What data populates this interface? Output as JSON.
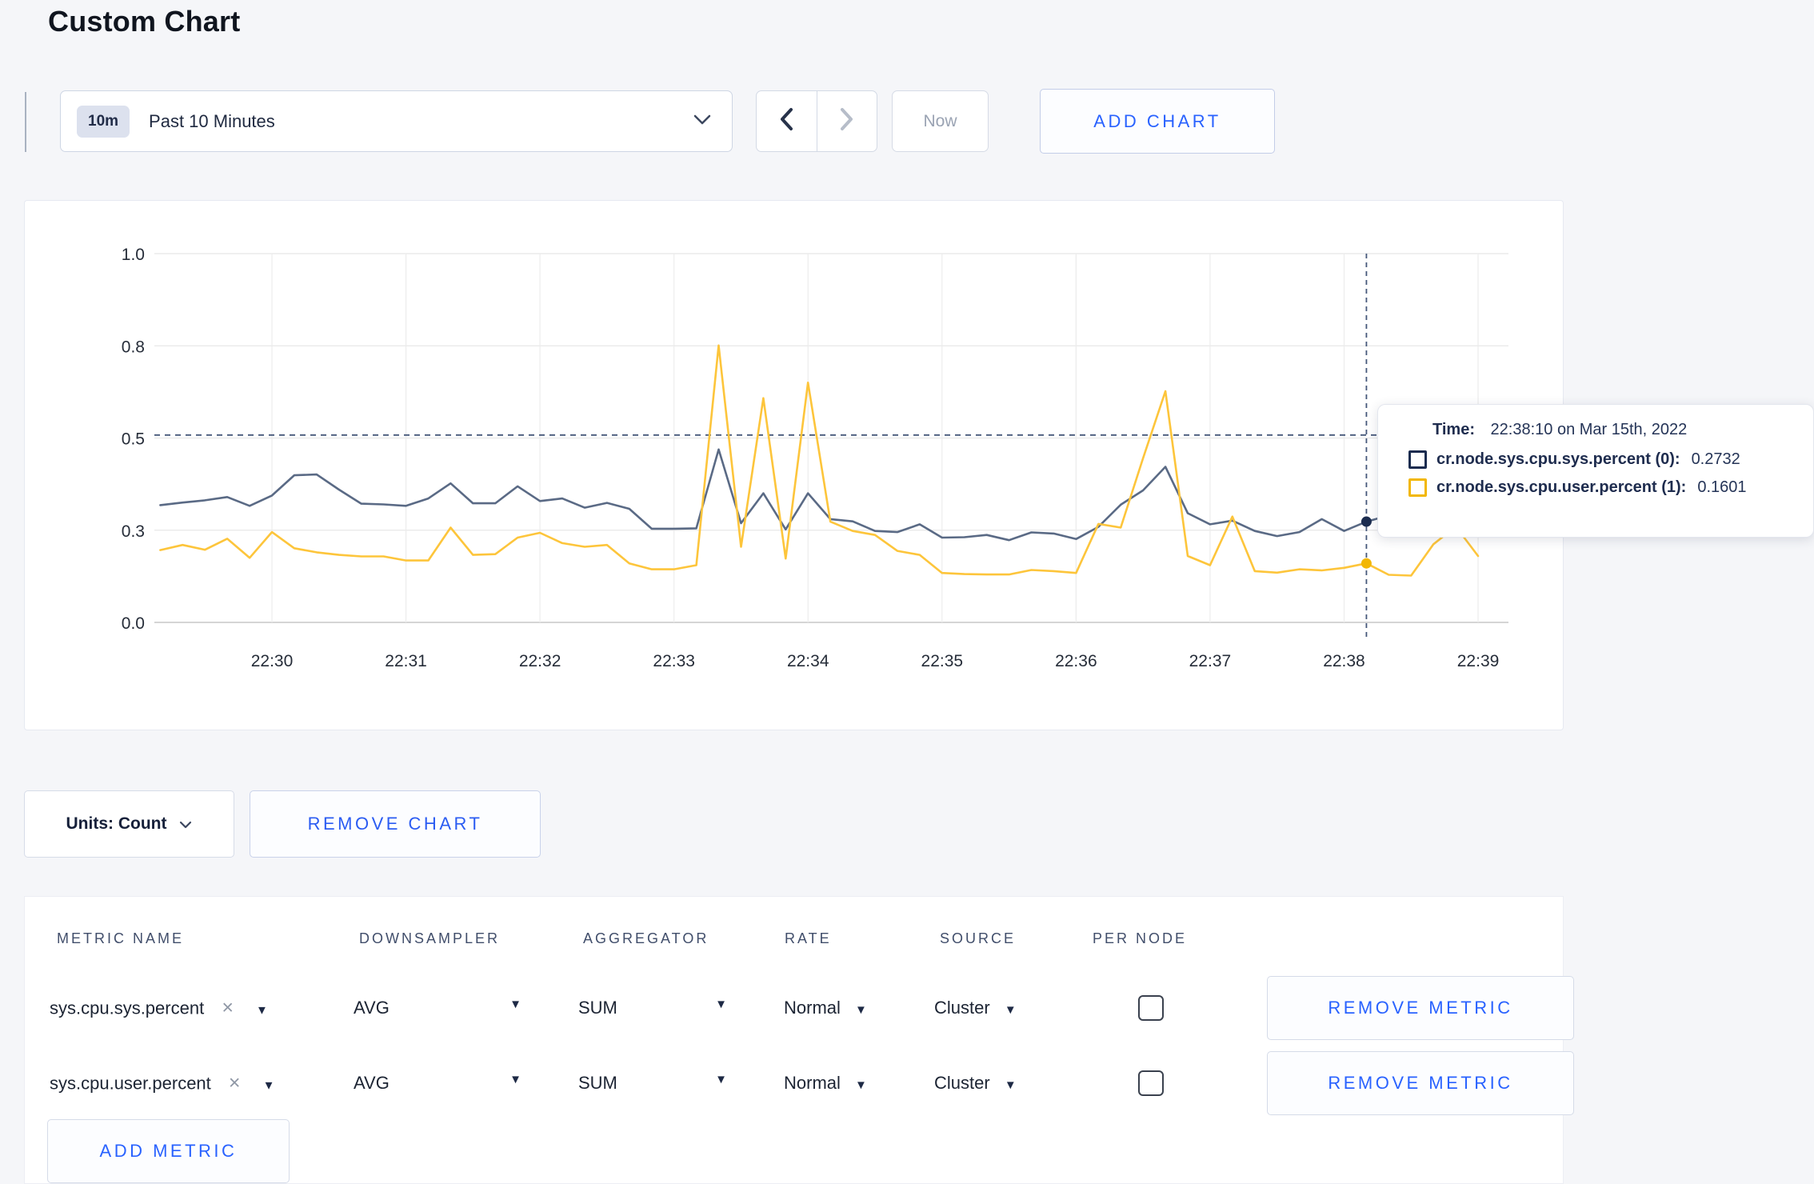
{
  "page": {
    "title": "Custom Chart",
    "background": "#f5f6f9"
  },
  "colors": {
    "accent_blue": "#2962ff",
    "sys_series": "#5a6a85",
    "user_series": "#fdc53b",
    "sys_swatch": "#1b2c4f",
    "user_swatch": "#f2b705",
    "gridline": "#e7e7e7",
    "axis_line": "#cfcfcf",
    "crosshair": "#46587a"
  },
  "toolbar": {
    "time_range": {
      "badge": "10m",
      "label": "Past 10 Minutes"
    },
    "prev_icon": "chevron-left",
    "next_icon": "chevron-right",
    "now_label": "Now",
    "add_chart_label": "ADD CHART"
  },
  "chart_data": {
    "type": "line",
    "title": "",
    "xlabel": "",
    "ylabel": "",
    "grid": true,
    "legend_position": "none",
    "x_ticks": [
      "22:30",
      "22:31",
      "22:32",
      "22:33",
      "22:34",
      "22:35",
      "22:36",
      "22:37",
      "22:38",
      "22:39"
    ],
    "y_axis": {
      "min": 0,
      "max": 1.0,
      "gridlines": [
        {
          "value": 0.0,
          "label": "0.0"
        },
        {
          "value": 0.25,
          "label": "0.3"
        },
        {
          "value": 0.5,
          "label": "0.5"
        },
        {
          "value": 0.75,
          "label": "0.8"
        },
        {
          "value": 1.0,
          "label": "1.0"
        }
      ]
    },
    "x": [
      "22:29:10",
      "22:29:20",
      "22:29:30",
      "22:29:40",
      "22:29:50",
      "22:30:00",
      "22:30:10",
      "22:30:20",
      "22:30:30",
      "22:30:40",
      "22:30:50",
      "22:31:00",
      "22:31:10",
      "22:31:20",
      "22:31:30",
      "22:31:40",
      "22:31:50",
      "22:32:00",
      "22:32:10",
      "22:32:20",
      "22:32:30",
      "22:32:40",
      "22:32:50",
      "22:33:00",
      "22:33:10",
      "22:33:20",
      "22:33:30",
      "22:33:40",
      "22:33:50",
      "22:34:00",
      "22:34:10",
      "22:34:20",
      "22:34:30",
      "22:34:40",
      "22:34:50",
      "22:35:00",
      "22:35:10",
      "22:35:20",
      "22:35:30",
      "22:35:40",
      "22:35:50",
      "22:36:00",
      "22:36:10",
      "22:36:20",
      "22:36:30",
      "22:36:40",
      "22:36:50",
      "22:37:00",
      "22:37:10",
      "22:37:20",
      "22:37:30",
      "22:37:40",
      "22:37:50",
      "22:38:00",
      "22:38:10",
      "22:38:20",
      "22:38:30",
      "22:38:40",
      "22:38:50",
      "22:39:00"
    ],
    "series": [
      {
        "name": "cr.node.sys.cpu.sys.percent (0)",
        "color": "#5a6a85",
        "values": [
          0.318,
          0.325,
          0.331,
          0.34,
          0.316,
          0.344,
          0.399,
          0.401,
          0.36,
          0.322,
          0.32,
          0.316,
          0.336,
          0.377,
          0.323,
          0.323,
          0.369,
          0.329,
          0.336,
          0.311,
          0.324,
          0.308,
          0.254,
          0.254,
          0.255,
          0.469,
          0.269,
          0.35,
          0.252,
          0.35,
          0.28,
          0.274,
          0.248,
          0.245,
          0.266,
          0.23,
          0.231,
          0.237,
          0.223,
          0.244,
          0.241,
          0.226,
          0.259,
          0.319,
          0.358,
          0.422,
          0.296,
          0.266,
          0.276,
          0.248,
          0.234,
          0.245,
          0.28,
          0.248,
          0.2732,
          0.29,
          0.301,
          0.31,
          0.3,
          0.302
        ]
      },
      {
        "name": "cr.node.sys.cpu.user.percent (1)",
        "color": "#fdc53b",
        "values": [
          0.196,
          0.21,
          0.197,
          0.227,
          0.175,
          0.245,
          0.201,
          0.19,
          0.183,
          0.179,
          0.179,
          0.168,
          0.168,
          0.257,
          0.183,
          0.185,
          0.23,
          0.243,
          0.215,
          0.205,
          0.21,
          0.16,
          0.144,
          0.144,
          0.155,
          0.751,
          0.205,
          0.608,
          0.173,
          0.65,
          0.273,
          0.248,
          0.237,
          0.194,
          0.183,
          0.134,
          0.131,
          0.13,
          0.13,
          0.142,
          0.139,
          0.134,
          0.267,
          0.257,
          0.445,
          0.627,
          0.18,
          0.155,
          0.287,
          0.139,
          0.135,
          0.144,
          0.141,
          0.148,
          0.1601,
          0.129,
          0.127,
          0.212,
          0.26,
          0.18
        ]
      }
    ],
    "crosshair": {
      "time": "22:38:10",
      "hline_value": 0.508,
      "point_values": [
        0.2732,
        0.1601
      ]
    }
  },
  "tooltip": {
    "time_label": "Time:",
    "time_value": "22:38:10 on Mar 15th, 2022",
    "rows": [
      {
        "label": "cr.node.sys.cpu.sys.percent (0):",
        "value": "0.2732",
        "color": "#1b2c4f"
      },
      {
        "label": "cr.node.sys.cpu.user.percent (1):",
        "value": "0.1601",
        "color": "#f2b705"
      }
    ]
  },
  "units": {
    "label": "Units: Count"
  },
  "remove_chart_label": "REMOVE CHART",
  "metrics_table": {
    "headers": [
      "METRIC NAME",
      "DOWNSAMPLER",
      "AGGREGATOR",
      "RATE",
      "SOURCE",
      "PER NODE"
    ],
    "remove_metric_label": "REMOVE METRIC",
    "add_metric_label": "ADD METRIC",
    "rows": [
      {
        "metric": "sys.cpu.sys.percent",
        "downsampler": "AVG",
        "aggregator": "SUM",
        "rate": "Normal",
        "source": "Cluster",
        "per_node": false
      },
      {
        "metric": "sys.cpu.user.percent",
        "downsampler": "AVG",
        "aggregator": "SUM",
        "rate": "Normal",
        "source": "Cluster",
        "per_node": false
      }
    ]
  }
}
